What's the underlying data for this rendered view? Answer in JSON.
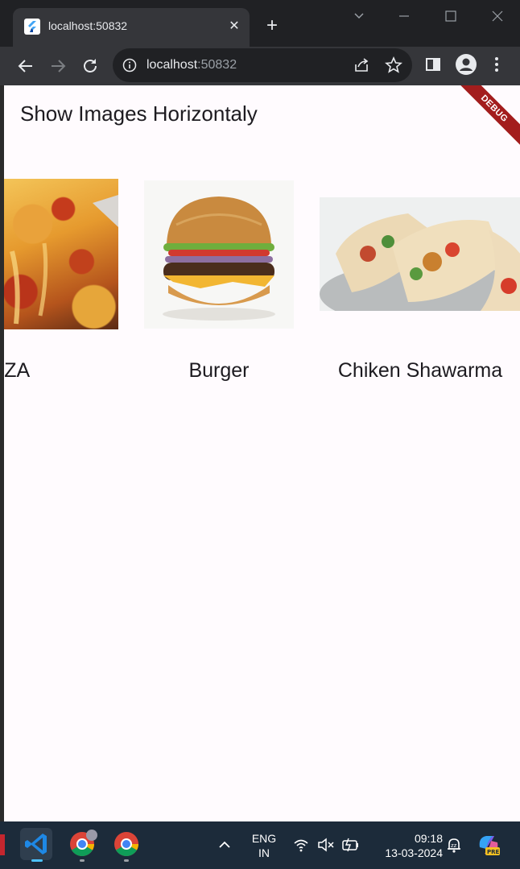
{
  "browser": {
    "tab_title": "localhost:50832",
    "url_host": "localhost",
    "url_port": ":50832",
    "tab_close": "✕",
    "new_tab": "+"
  },
  "app": {
    "title": "Show Images Horizontaly",
    "debug_banner": "DEBUG",
    "items": [
      {
        "label": "PIZZA",
        "visible_label": "IZZA"
      },
      {
        "label": "Burger"
      },
      {
        "label": "Chiken Shawarma"
      }
    ]
  },
  "taskbar": {
    "language_line1": "ENG",
    "language_line2": "IN",
    "time": "09:18",
    "date": "13-03-2024"
  },
  "colors": {
    "chrome_dark": "#202124",
    "chrome_toolbar": "#35363a",
    "page_bg": "#fffbfe",
    "debug_red": "#a31d1d",
    "taskbar_bg": "#1c2b3a"
  }
}
